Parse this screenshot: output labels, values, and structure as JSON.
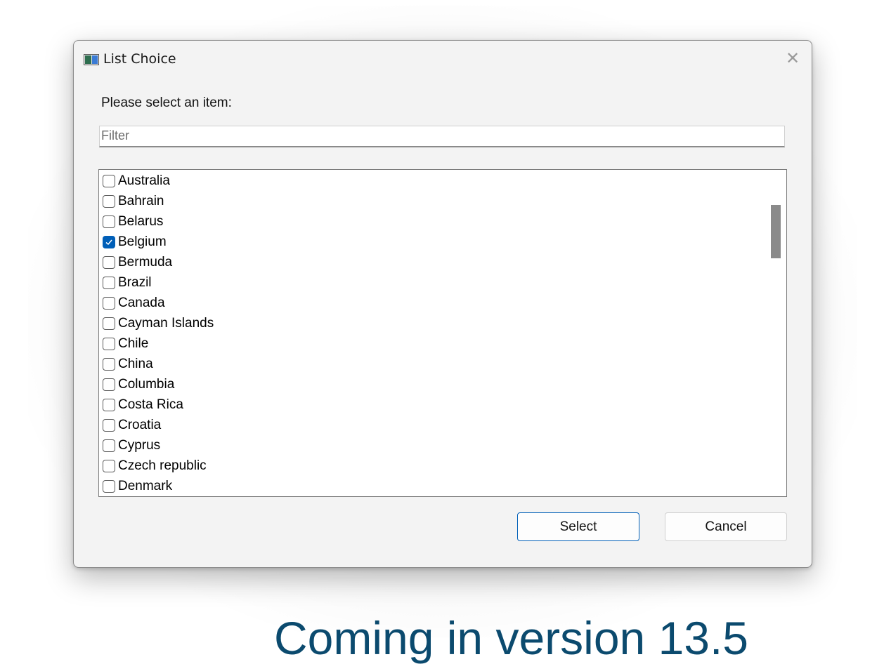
{
  "window": {
    "title": "List Choice",
    "close_symbol": "✕"
  },
  "prompt": "Please select an item:",
  "filter": {
    "value": "",
    "placeholder": "Filter"
  },
  "list": {
    "items": [
      {
        "label": "Australia",
        "checked": false
      },
      {
        "label": "Bahrain",
        "checked": false
      },
      {
        "label": "Belarus",
        "checked": false
      },
      {
        "label": "Belgium",
        "checked": true
      },
      {
        "label": "Bermuda",
        "checked": false
      },
      {
        "label": "Brazil",
        "checked": false
      },
      {
        "label": "Canada",
        "checked": false
      },
      {
        "label": "Cayman Islands",
        "checked": false
      },
      {
        "label": "Chile",
        "checked": false
      },
      {
        "label": "China",
        "checked": false
      },
      {
        "label": "Columbia",
        "checked": false
      },
      {
        "label": "Costa Rica",
        "checked": false
      },
      {
        "label": "Croatia",
        "checked": false
      },
      {
        "label": "Cyprus",
        "checked": false
      },
      {
        "label": "Czech republic",
        "checked": false
      },
      {
        "label": "Denmark",
        "checked": false
      }
    ],
    "scroll_position": 0.1
  },
  "buttons": {
    "select": "Select",
    "cancel": "Cancel"
  },
  "caption": "Coming in version 13.5",
  "colors": {
    "accent": "#005fb8",
    "caption": "#0b4a6e"
  },
  "icons": {
    "app": "app-window-icon",
    "close": "close-icon",
    "check": "checkmark-icon"
  }
}
